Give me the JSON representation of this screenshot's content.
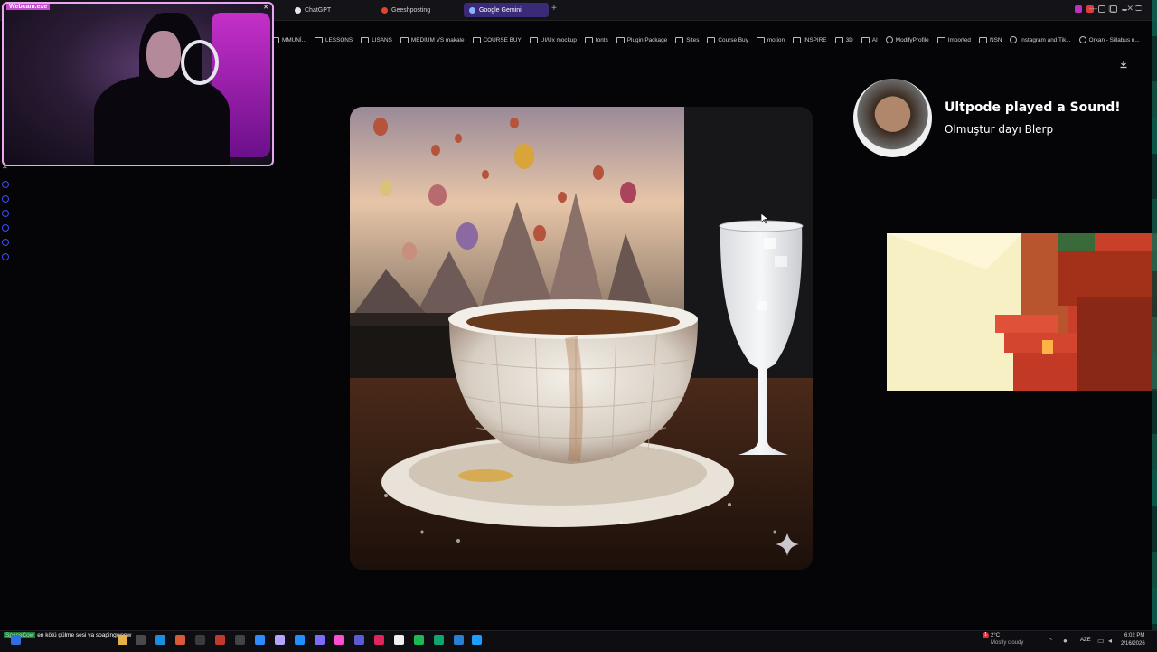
{
  "browser": {
    "tabs": [
      {
        "label": "ChatGPT",
        "favicon_color": "#e8e8e8"
      },
      {
        "label": "Geeshposting",
        "favicon_color": "#e0452d"
      },
      {
        "label": "Google Gemini",
        "favicon_color": "#8ab4ff"
      }
    ],
    "new_tab_symbol": "+",
    "window_buttons": [
      "—",
      "▢",
      "✕"
    ],
    "bookmarks": [
      {
        "label": "MMUNİ...",
        "type": "folder"
      },
      {
        "label": "LESSONS",
        "type": "folder"
      },
      {
        "label": "LISANS",
        "type": "folder"
      },
      {
        "label": "MEDIUM VS makale",
        "type": "folder"
      },
      {
        "label": "COURSE BUY",
        "type": "folder"
      },
      {
        "label": "UI/Ux mockup",
        "type": "folder"
      },
      {
        "label": "fonts",
        "type": "folder"
      },
      {
        "label": "Plugin Package",
        "type": "folder"
      },
      {
        "label": "Sites",
        "type": "folder"
      },
      {
        "label": "Course Buy",
        "type": "folder"
      },
      {
        "label": "motion",
        "type": "folder"
      },
      {
        "label": "INSPIRE",
        "type": "folder"
      },
      {
        "label": "3D",
        "type": "folder"
      },
      {
        "label": "AI",
        "type": "folder"
      },
      {
        "label": "ModifyProfile",
        "type": "site"
      },
      {
        "label": "Imported",
        "type": "folder"
      },
      {
        "label": "NSN",
        "type": "folder"
      },
      {
        "label": "Instagram and Tik...",
        "type": "site"
      },
      {
        "label": "Orxan - Sillabus n...",
        "type": "site"
      }
    ],
    "download_icon": "download-icon"
  },
  "webcam": {
    "title": "Webcam.exe",
    "close": "✕"
  },
  "notification": {
    "title": "Ultpode played a Sound!",
    "subtitle": "Olmuştur dayı Blerp"
  },
  "main_image": {
    "sparkle_icon": "gemini-sparkle-icon"
  },
  "taskbar": {
    "chat_nick": "SpaceCow",
    "chat_text": "en kötü gülme sesi ya soapingwepw",
    "weather_temp": "2°C",
    "weather_desc": "Mostly cloudy",
    "weather_badge": "1",
    "language": "AZE",
    "time": "6:02 PM",
    "date": "2/16/2026",
    "app_icon_colors": [
      "#2f6fe0",
      "#e8b04a",
      "#4a4a4a",
      "#1e8de0",
      "#d85a3a",
      "#3a3a3a",
      "#c0392b",
      "#444",
      "#2d8cff",
      "#b2a5ff",
      "#1e90ff",
      "#7b6cff",
      "#ff4dd2",
      "#5b5bd6",
      "#e0245e",
      "#f0f0f0",
      "#1db954",
      "#0ea66e",
      "#2a7fd4",
      "#1a9fff"
    ]
  }
}
